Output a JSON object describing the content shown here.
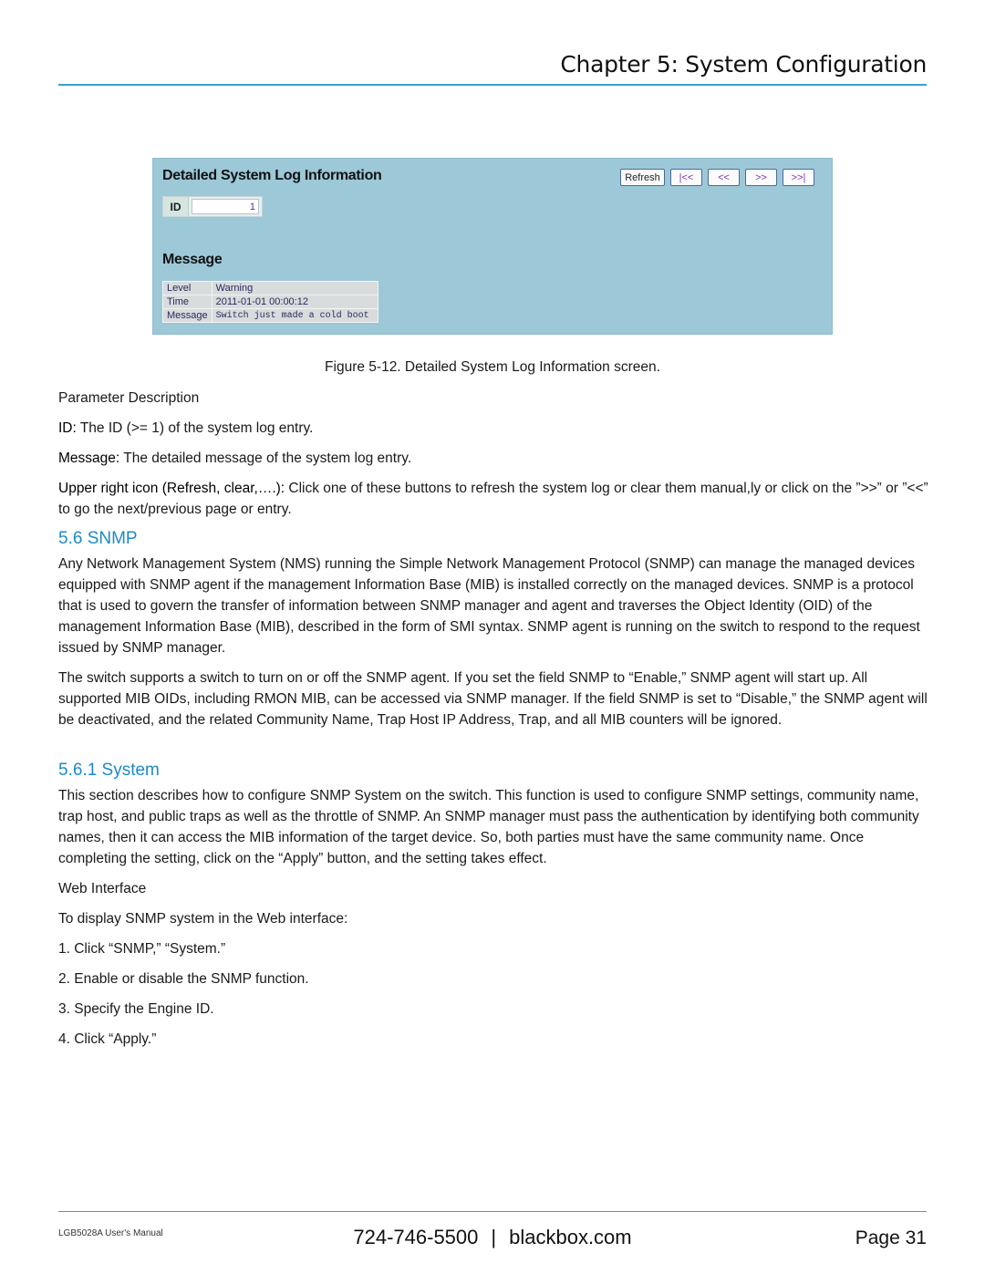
{
  "header": {
    "chapter_title": "Chapter 5: System Configuration"
  },
  "figure": {
    "title": "Detailed System Log Information",
    "id_label": "ID",
    "id_value": "1",
    "buttons": {
      "refresh": "Refresh",
      "first": "|<<",
      "prev": "<<",
      "next": ">>",
      "last": ">>|"
    },
    "message_title": "Message",
    "message_rows": [
      {
        "key": "Level",
        "value": "Warning"
      },
      {
        "key": "Time",
        "value": "2011-01-01 00:00:12"
      },
      {
        "key": "Message",
        "value": "Switch just made a cold boot"
      }
    ],
    "colors": {
      "panel_bg": "#9cc8d8",
      "heading_blue": "#1e8ac6"
    }
  },
  "caption": "Figure 5-12. Detailed System Log Information screen.",
  "params": {
    "heading": "Parameter Description",
    "items": [
      {
        "term": "ID:",
        "desc": " The ID (>= 1) of the system log entry."
      },
      {
        "term": "Message:",
        "desc": " The detailed message of the system log entry."
      },
      {
        "term": "Upper right icon (Refresh, clear,….):",
        "desc": " Click one of these buttons to refresh the system log or clear them manual,ly or click on the ”>>” or ”<<” to go the next/previous page or entry."
      }
    ]
  },
  "section_snmp": {
    "heading": "5.6 SNMP",
    "para1": "Any Network Management System (NMS) running the Simple Network Management Protocol (SNMP) can manage the managed devices equipped with SNMP agent if the management Information Base (MIB) is installed correctly on the managed devices. SNMP is a protocol that is used to govern the transfer of information between SNMP manager and agent and traverses the Object Identity (OID) of the management Information Base (MIB), described in the form of SMI syntax. SNMP agent is running on the switch to respond to the request issued by SNMP manager.",
    "para2": "The switch supports a switch to turn on or off the SNMP agent. If you set the field SNMP to “Enable,” SNMP agent will start up. All supported MIB OIDs, including RMON MIB, can be accessed via SNMP manager. If the field SNMP is set to “Disable,” the SNMP agent will be deactivated, and the related Community Name, Trap Host IP Address, Trap, and all MIB counters will be ignored."
  },
  "section_system": {
    "heading": "5.6.1 System",
    "para": "This section describes how to configure SNMP System on the switch. This function is used to configure SNMP settings, community name, trap host, and public traps as well as the throttle of SNMP. An SNMP manager must pass the authentication by identifying both community names, then it can access the MIB information of the target device. So, both parties must have the same community name. Once completing the setting, click on the “Apply” button, and the setting takes effect.",
    "web_heading": "Web Interface",
    "intro": "To display SNMP system in the Web interface:",
    "steps": [
      "1. Click “SNMP,” “System.”",
      "2. Enable or disable the SNMP function.",
      "3. Specify the Engine ID.",
      "4. Click “Apply.”"
    ]
  },
  "footer": {
    "manual": "LGB5028A User's Manual",
    "phone": "724-746-5500",
    "separator": "|",
    "website": "blackbox.com",
    "page": "Page 31"
  }
}
